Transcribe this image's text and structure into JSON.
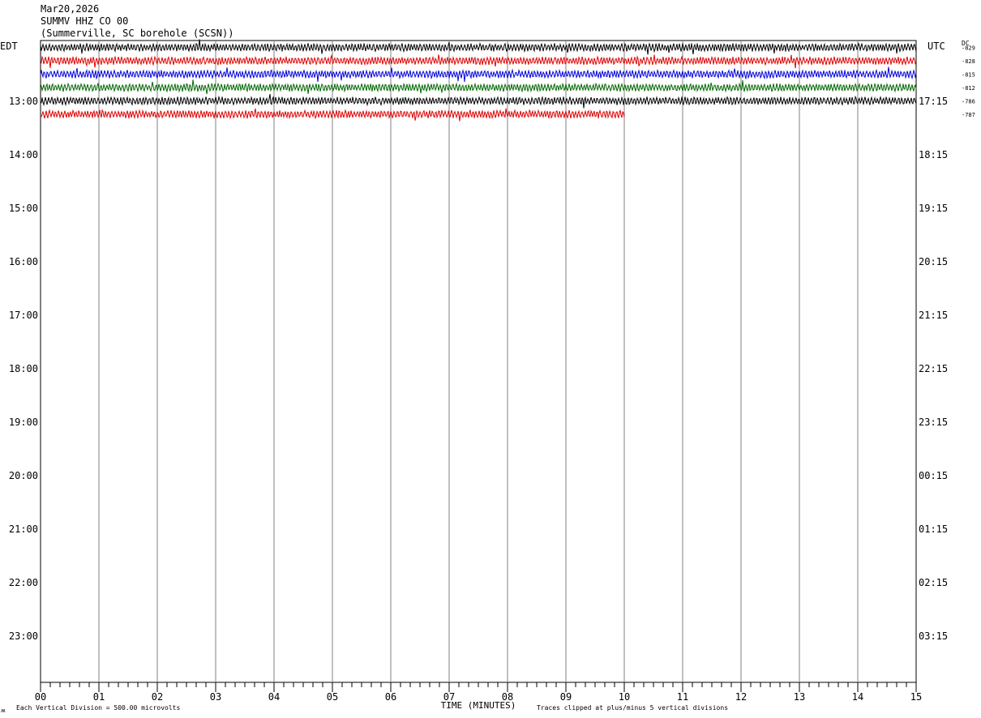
{
  "header": {
    "date": "Mar20,2026",
    "station": "SUMMV HHZ CO 00",
    "location": "(Summerville, SC borehole (SCSN))"
  },
  "labels": {
    "left_tz": "EDT",
    "right_tz": "UTC",
    "dc_label": "DC",
    "xlabel": "TIME (MINUTES)",
    "footer_left": "Each Vertical Division =  500.00 microvolts",
    "footer_right": "Traces clipped at plus/minus 5 vertical divisions",
    "corner_mark": "ʍ"
  },
  "chart_data": {
    "type": "line",
    "title": "",
    "xlabel": "TIME (MINUTES)",
    "xlim": [
      0,
      15
    ],
    "x_ticks": [
      "00",
      "01",
      "02",
      "03",
      "04",
      "05",
      "06",
      "07",
      "08",
      "09",
      "10",
      "11",
      "12",
      "13",
      "14",
      "15"
    ],
    "left_hour_labels": [
      "13:00",
      "14:00",
      "15:00",
      "16:00",
      "17:00",
      "18:00",
      "19:00",
      "20:00",
      "21:00",
      "22:00",
      "23:00"
    ],
    "right_hour_labels": [
      "17:15",
      "18:15",
      "19:15",
      "20:15",
      "21:15",
      "22:15",
      "23:15",
      "00:15",
      "01:15",
      "02:15",
      "03:15"
    ],
    "trace_rows_per_hour": 4,
    "vertical_grid": true,
    "traces": [
      {
        "color": "#000000",
        "dc": "-829",
        "end_minute": 15
      },
      {
        "color": "#dd0000",
        "dc": "-828",
        "end_minute": 15
      },
      {
        "color": "#0000dd",
        "dc": "-815",
        "end_minute": 15
      },
      {
        "color": "#006600",
        "dc": "-812",
        "end_minute": 15
      },
      {
        "color": "#000000",
        "dc": "-786",
        "end_minute": 15
      },
      {
        "color": "#dd0000",
        "dc": "-787",
        "end_minute": 10
      }
    ]
  }
}
